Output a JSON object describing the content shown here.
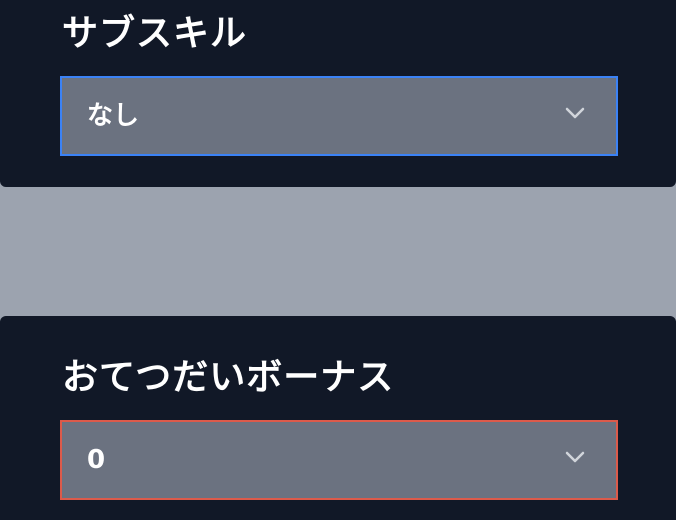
{
  "subskill": {
    "label": "サブスキル",
    "selected_value": "なし",
    "dropdown_icon": "chevron-down",
    "border_color": "#3b82f6"
  },
  "helper_bonus": {
    "label": "おてつだいボーナス",
    "selected_value": "0",
    "dropdown_icon": "chevron-down",
    "border_color": "#dc5a4a"
  },
  "colors": {
    "panel_background": "#111827",
    "page_background": "#9ca3af",
    "select_background": "#6b7280"
  }
}
